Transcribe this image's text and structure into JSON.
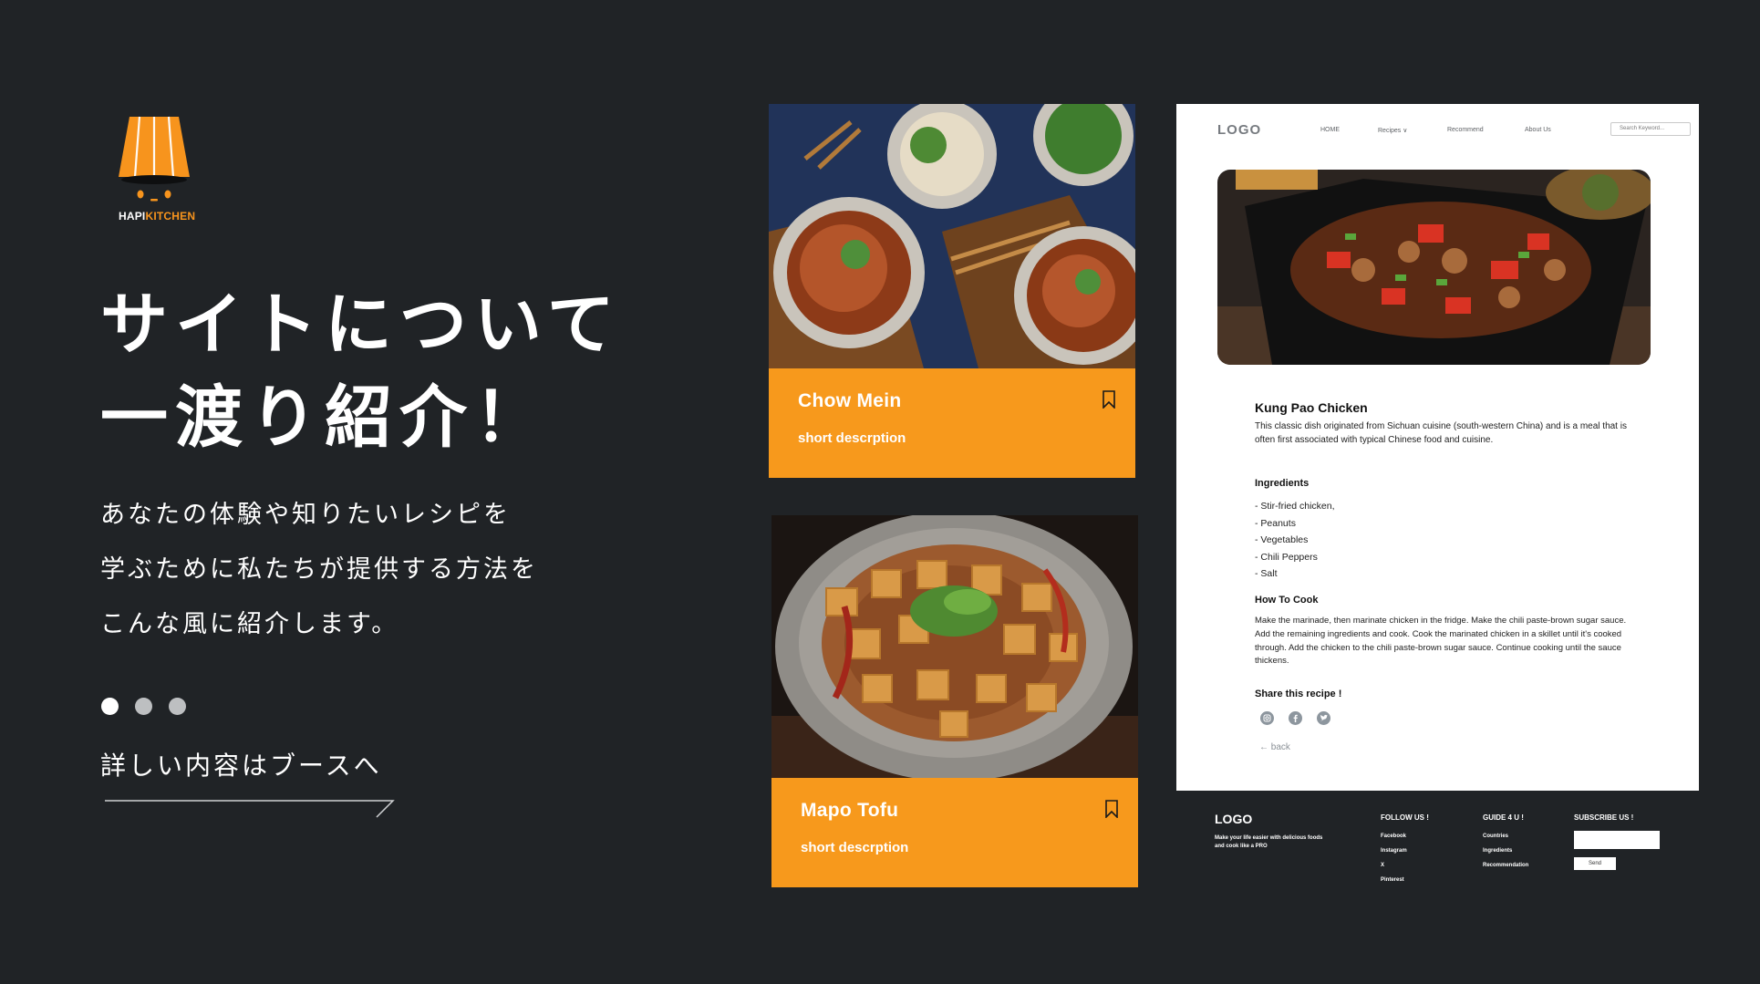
{
  "brand": {
    "name_part1": "HAPI",
    "name_part2": "KITCHEN",
    "accent_color": "#f7941d"
  },
  "headline": {
    "line1": "サイトについて",
    "line2": "一渡り紹介！"
  },
  "lead": {
    "line1": "あなたの体験や知りたいレシピを",
    "line2": "学ぶために私たちが提供する方法を",
    "line3": "こんな風に紹介します。"
  },
  "pager": {
    "count": 3,
    "active_index": 0
  },
  "booth_link": "詳しい内容はブースへ",
  "cards": [
    {
      "title": "Chow Mein",
      "description": "short descrption",
      "icon": "bookmark-icon"
    },
    {
      "title": "Mapo Tofu",
      "description": "short descrption",
      "icon": "bookmark-icon"
    }
  ],
  "recipe_page": {
    "logo": "LOGO",
    "nav": {
      "home": "HOME",
      "recipes": "Recipes ∨",
      "recommend": "Recommend",
      "about": "About Us"
    },
    "search_placeholder": "Search Keyword...",
    "title": "Kung Pao Chicken",
    "intro": "This classic dish originated from Sichuan cuisine (south-western China) and is a meal that is often first associated with typical Chinese food and cuisine.",
    "ingredients_heading": "Ingredients",
    "ingredients": [
      "- Stir-fried chicken,",
      "- Peanuts",
      "- Vegetables",
      "- Chili Peppers",
      "- Salt"
    ],
    "how_to_heading": "How To Cook",
    "how_to": "Make the marinade, then marinate chicken in the fridge. Make the chili paste-brown sugar sauce. Add the remaining ingredients and cook. Cook the marinated chicken in a skillet until it's cooked through. Add the chicken to the chili paste-brown sugar sauce. Continue cooking until the sauce thickens.",
    "share_heading": "Share this recipe !",
    "share_icons": [
      "instagram-icon",
      "facebook-icon",
      "twitter-icon"
    ],
    "back": "← back"
  },
  "footer": {
    "logo": "LOGO",
    "tagline": "Make your life easier with delicious foods and cook like a PRO",
    "follow_heading": "FOLLOW US !",
    "follow_links": [
      "Facebook",
      "Instagram",
      "X",
      "Pinterest"
    ],
    "guide_heading": "GUIDE 4 U !",
    "guide_links": [
      "Countries",
      "Ingredients",
      "Recommendation"
    ],
    "subscribe_heading": "SUBSCRIBE US !",
    "send_label": "Send"
  },
  "colors": {
    "background": "#202326",
    "accent": "#f7991c",
    "text": "#ffffff"
  }
}
